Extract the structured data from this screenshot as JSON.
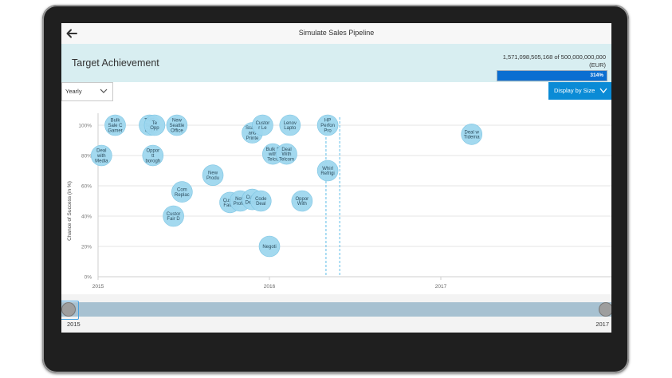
{
  "app": {
    "title": "Simulate Sales Pipeline"
  },
  "header": {
    "title": "Target Achievement",
    "target_value": "1,571,098,505,168 of 500,000,000,000",
    "target_unit": "(EUR)",
    "progress_label": "314%",
    "progress_fraction": 1.0
  },
  "toolbar": {
    "period_value": "Yearly",
    "display_button": "Display by Size"
  },
  "colors": {
    "accent": "#0a8bd6",
    "bubble": "#9ed7ee",
    "header_bg": "#d8eef1",
    "guide_line": "#4db7e6"
  },
  "slider": {
    "start_label": "2015",
    "end_label": "2017"
  },
  "chart_data": {
    "type": "scatter",
    "ylabel": "Chance of Success (in %)",
    "xlabel": "",
    "x_ticks": [
      "2015",
      "2016",
      "2017"
    ],
    "y_ticks": [
      "0%",
      "20%",
      "40%",
      "60%",
      "80%",
      "100%"
    ],
    "xlim": [
      2015.0,
      2018.0
    ],
    "ylim": [
      0,
      105
    ],
    "guide_lines_x": [
      2016.33,
      2016.41
    ],
    "points": [
      {
        "label": "Bulk Sale C",
        "lines": [
          "Bulk",
          "Sale C",
          "Gamer"
        ],
        "x": 2015.1,
        "y": 100
      },
      {
        "label": "TMB Test",
        "lines": [
          "TMB",
          "Test",
          "Opp"
        ],
        "x": 2015.3,
        "y": 100
      },
      {
        "label": "Test Opp",
        "lines": [
          "Te",
          "Opp"
        ],
        "x": 2015.33,
        "y": 100
      },
      {
        "label": "New Seattle Office",
        "lines": [
          "New",
          "Seattle",
          "Office"
        ],
        "x": 2015.46,
        "y": 100
      },
      {
        "label": "Deal with Media",
        "lines": [
          "Deal",
          "with",
          "Media"
        ],
        "x": 2015.02,
        "y": 80
      },
      {
        "label": "Opportunity",
        "lines": [
          "Oppor",
          "tt",
          "borogh"
        ],
        "x": 2015.32,
        "y": 80
      },
      {
        "label": "New Product",
        "lines": [
          "New",
          "Produ"
        ],
        "x": 2015.67,
        "y": 67
      },
      {
        "label": "Com Replac",
        "lines": [
          "Com",
          "Replac"
        ],
        "x": 2015.49,
        "y": 56
      },
      {
        "label": "Customer Fair D",
        "lines": [
          "Custor",
          "Fair D"
        ],
        "x": 2015.44,
        "y": 40
      },
      {
        "label": "Scanner and Printer",
        "lines": [
          "Scann",
          "and",
          "Printe"
        ],
        "x": 2015.9,
        "y": 95
      },
      {
        "label": "Customer Lead",
        "lines": [
          "Custor",
          "r Le"
        ],
        "x": 2015.96,
        "y": 100
      },
      {
        "label": "Lenovo Laptop",
        "lines": [
          "Lenov",
          "Lapto"
        ],
        "x": 2016.12,
        "y": 100
      },
      {
        "label": "Bulk Sale with Telco",
        "lines": [
          "Bulk S",
          "with",
          "Telco"
        ],
        "x": 2016.02,
        "y": 81
      },
      {
        "label": "Deal With Telecom",
        "lines": [
          "Deal",
          "With",
          "Telcom"
        ],
        "x": 2016.1,
        "y": 81
      },
      {
        "label": "Customer Fair Dubai",
        "lines": [
          "Custor",
          "Fair D"
        ],
        "x": 2015.77,
        "y": 49
      },
      {
        "label": "Note Professional",
        "lines": [
          "Note",
          "Profes"
        ],
        "x": 2015.83,
        "y": 50
      },
      {
        "label": "Customer Dealer",
        "lines": [
          "Custo",
          "Dealer"
        ],
        "x": 2015.9,
        "y": 51
      },
      {
        "label": "Code Deal",
        "lines": [
          "Code",
          "Deal"
        ],
        "x": 2015.95,
        "y": 50
      },
      {
        "label": "Opportunity With",
        "lines": [
          "Oppor",
          "With"
        ],
        "x": 2016.19,
        "y": 50
      },
      {
        "label": "HP Performance Pro",
        "lines": [
          "HP",
          "Perfon",
          "Pro"
        ],
        "x": 2016.34,
        "y": 100
      },
      {
        "label": "Whirlpool Refrigerator",
        "lines": [
          "Whirl",
          "Refrigi"
        ],
        "x": 2016.34,
        "y": 70
      },
      {
        "label": "Negotiation",
        "lines": [
          "Negoti"
        ],
        "x": 2016.0,
        "y": 20
      },
      {
        "label": "Deal with Tidemark",
        "lines": [
          "Deal w",
          "Tidema"
        ],
        "x": 2017.18,
        "y": 94
      }
    ]
  }
}
